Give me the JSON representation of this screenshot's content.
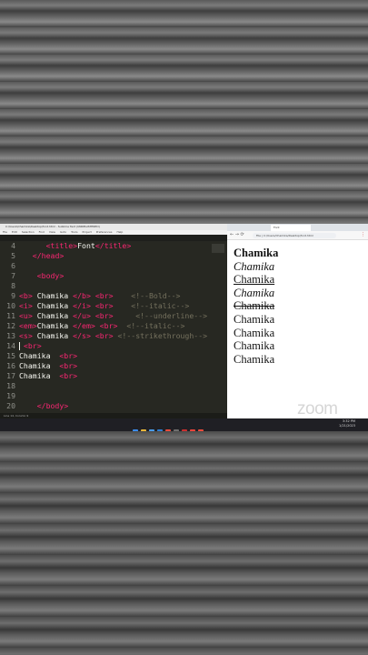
{
  "editor": {
    "title": "C:\\Users\\Chamika\\Desktop\\font.html - Sublime Text (UNREGISTERED)",
    "menu": [
      "File",
      "Edit",
      "Selection",
      "Find",
      "View",
      "Goto",
      "Tools",
      "Project",
      "Preferences",
      "Help"
    ],
    "tab": "font.html",
    "status": "Line 14, Column 9",
    "lines": [
      {
        "n": "4",
        "parts": [
          {
            "c": "w",
            "t": "      "
          },
          {
            "c": "t",
            "t": "<"
          },
          {
            "c": "t",
            "t": "title"
          },
          {
            "c": "t",
            "t": ">"
          },
          {
            "c": "p",
            "t": "Font"
          },
          {
            "c": "t",
            "t": "</"
          },
          {
            "c": "t",
            "t": "title"
          },
          {
            "c": "t",
            "t": ">"
          }
        ]
      },
      {
        "n": "5",
        "parts": [
          {
            "c": "w",
            "t": "   "
          },
          {
            "c": "t",
            "t": "</head>"
          }
        ]
      },
      {
        "n": "6",
        "parts": []
      },
      {
        "n": "7",
        "parts": [
          {
            "c": "w",
            "t": "    "
          },
          {
            "c": "t",
            "t": "<body>"
          }
        ]
      },
      {
        "n": "8",
        "parts": []
      },
      {
        "n": "9",
        "parts": [
          {
            "c": "t",
            "t": "<b>"
          },
          {
            "c": "p",
            "t": " Chamika "
          },
          {
            "c": "t",
            "t": "</b>"
          },
          {
            "c": "p",
            "t": " "
          },
          {
            "c": "t",
            "t": "<br>"
          },
          {
            "c": "p",
            "t": "    "
          },
          {
            "c": "c",
            "t": "<!--Bold-->"
          }
        ]
      },
      {
        "n": "10",
        "parts": [
          {
            "c": "t",
            "t": "<i>"
          },
          {
            "c": "p",
            "t": " Chamika "
          },
          {
            "c": "t",
            "t": "</i>"
          },
          {
            "c": "p",
            "t": " "
          },
          {
            "c": "t",
            "t": "<br>"
          },
          {
            "c": "p",
            "t": "    "
          },
          {
            "c": "c",
            "t": "<!--italic-->"
          }
        ]
      },
      {
        "n": "11",
        "parts": [
          {
            "c": "t",
            "t": "<u>"
          },
          {
            "c": "p",
            "t": " Chamika "
          },
          {
            "c": "t",
            "t": "</u>"
          },
          {
            "c": "p",
            "t": " "
          },
          {
            "c": "t",
            "t": "<br>"
          },
          {
            "c": "p",
            "t": "     "
          },
          {
            "c": "c",
            "t": "<!--underline-->"
          }
        ]
      },
      {
        "n": "12",
        "parts": [
          {
            "c": "t",
            "t": "<em>"
          },
          {
            "c": "p",
            "t": "Chamika "
          },
          {
            "c": "t",
            "t": "</em>"
          },
          {
            "c": "p",
            "t": " "
          },
          {
            "c": "t",
            "t": "<br>"
          },
          {
            "c": "p",
            "t": "  "
          },
          {
            "c": "c",
            "t": "<!--italic-->"
          }
        ]
      },
      {
        "n": "13",
        "parts": [
          {
            "c": "t",
            "t": "<s>"
          },
          {
            "c": "p",
            "t": " Chamika "
          },
          {
            "c": "t",
            "t": "</s>"
          },
          {
            "c": "p",
            "t": " "
          },
          {
            "c": "t",
            "t": "<br>"
          },
          {
            "c": "p",
            "t": " "
          },
          {
            "c": "c",
            "t": "<!--strikethrough-->"
          }
        ]
      },
      {
        "n": "14",
        "parts": [
          {
            "c": "p",
            "t": " "
          },
          {
            "c": "t",
            "t": "<br>"
          }
        ],
        "cursor": true
      },
      {
        "n": "15",
        "parts": [
          {
            "c": "p",
            "t": "Chamika  "
          },
          {
            "c": "t",
            "t": "<br>"
          }
        ]
      },
      {
        "n": "16",
        "parts": [
          {
            "c": "p",
            "t": "Chamika  "
          },
          {
            "c": "t",
            "t": "<br>"
          }
        ]
      },
      {
        "n": "17",
        "parts": [
          {
            "c": "p",
            "t": "Chamika  "
          },
          {
            "c": "t",
            "t": "<br>"
          }
        ]
      },
      {
        "n": "18",
        "parts": []
      },
      {
        "n": "19",
        "parts": []
      },
      {
        "n": "20",
        "parts": [
          {
            "c": "w",
            "t": "    "
          },
          {
            "c": "t",
            "t": "</body>"
          }
        ]
      }
    ]
  },
  "browser": {
    "tab_title": "Font",
    "url": "File | C:/Users/Chamika/Desktop/font.html",
    "nav": "← → ⟳",
    "output": [
      {
        "text": "Chamika",
        "style": "b"
      },
      {
        "text": "Chamika",
        "style": "i"
      },
      {
        "text": "Chamika",
        "style": "u"
      },
      {
        "text": "Chamika",
        "style": "i"
      },
      {
        "text": "Chamika",
        "style": "s"
      },
      {
        "text": "Chamika",
        "style": ""
      },
      {
        "text": "Chamika",
        "style": ""
      },
      {
        "text": "Chamika",
        "style": ""
      },
      {
        "text": "Chamika",
        "style": ""
      }
    ]
  },
  "watermark": "zoom",
  "taskbar": {
    "time": "3:32 PM",
    "date": "1/21/2023",
    "icon_colors": [
      "#3b8bea",
      "#e8b53a",
      "#4a9be8",
      "#2d7dd2",
      "#e84a3a",
      "#6f6f6f",
      "#c92f2f",
      "#e8433a",
      "#e84a3a"
    ]
  }
}
